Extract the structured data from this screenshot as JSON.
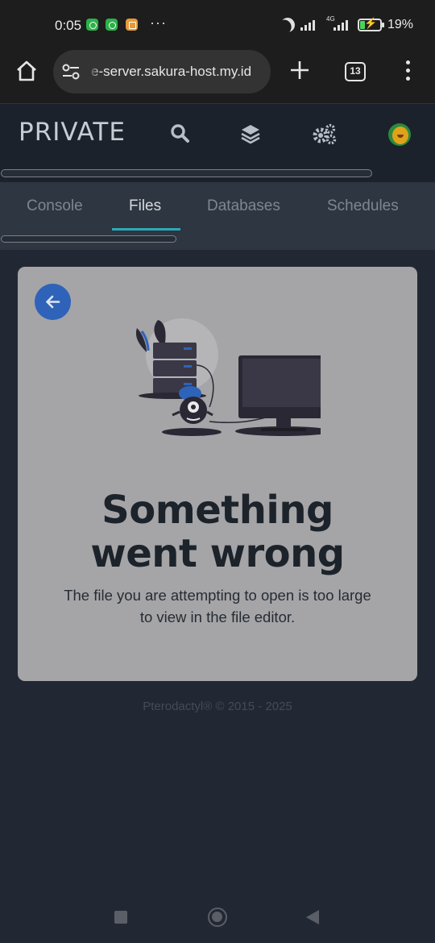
{
  "status_bar": {
    "time": "0:05",
    "overflow": "···",
    "network_label": "4G",
    "battery_percent": "19%",
    "icons": [
      "whatsapp-icon",
      "whatsapp-icon",
      "notes-icon",
      "moon-icon",
      "signal-icon",
      "battery-charging-icon"
    ]
  },
  "browser": {
    "url": "e-server.sakura-host.my.id",
    "tab_count": "13",
    "icons": [
      "home-icon",
      "site-settings-icon",
      "plus-icon",
      "tabs-icon",
      "more-vert-icon"
    ]
  },
  "app_nav": {
    "title": "PRIVATE",
    "icons": [
      "search-icon",
      "layers-icon",
      "cogs-icon",
      "avatar"
    ]
  },
  "sub_nav": {
    "tabs": [
      {
        "label": "Console",
        "active": false
      },
      {
        "label": "Files",
        "active": true
      },
      {
        "label": "Databases",
        "active": false
      },
      {
        "label": "Schedules",
        "active": false
      }
    ],
    "accent_color": "#2fa7b7"
  },
  "error_card": {
    "title_line1": "Something",
    "title_line2": "went wrong",
    "message": "The file you are attempting to open is too large to view in the file editor.",
    "back_icon": "arrow-left-icon",
    "illustration": "server-monster-computer-illustration"
  },
  "footer": {
    "text": "Pterodactyl® © 2015 - 2025"
  },
  "colors": {
    "background": "#222833",
    "card": "#a5a5a7",
    "back_button": "#2f63b9"
  }
}
